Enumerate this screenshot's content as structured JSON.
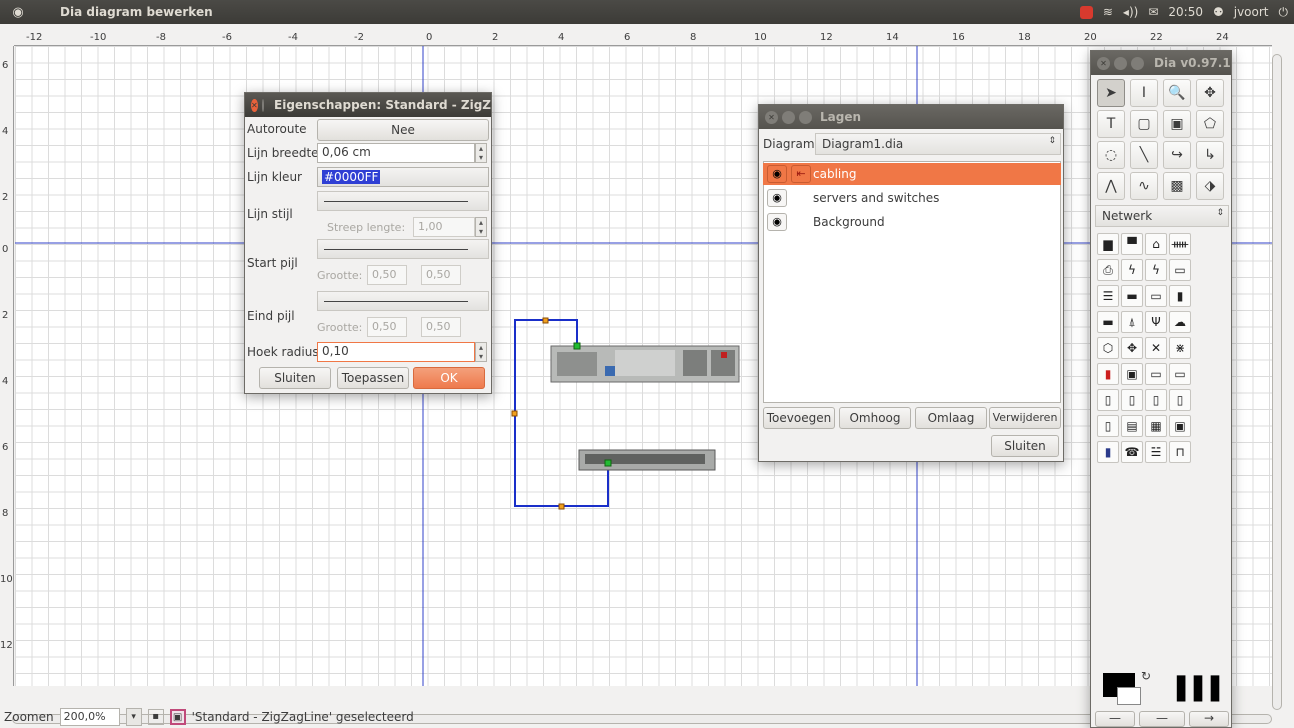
{
  "topbar": {
    "title": "Dia diagram bewerken",
    "time": "20:50",
    "user": "jvoort",
    "icons": [
      "app-logo-icon",
      "notification-icon",
      "wifi-icon",
      "volume-icon",
      "mail-icon",
      "user-icon",
      "power-icon"
    ]
  },
  "ruler": {
    "h_labels": [
      "-12",
      "-10",
      "-8",
      "-6",
      "-4",
      "-2",
      "0",
      "2",
      "4",
      "6",
      "8",
      "10",
      "12",
      "14",
      "16",
      "18",
      "20",
      "22",
      "24"
    ],
    "v_labels": [
      "6",
      "4",
      "2",
      "0",
      "2",
      "4",
      "6",
      "8",
      "10",
      "12"
    ]
  },
  "statusbar": {
    "zoom_label": "Zoomen",
    "zoom_value": "200,0%",
    "selection": "'Standard - ZigZagLine' geselecteerd"
  },
  "properties": {
    "title": "Eigenschappen: Standard - ZigZ",
    "autoroute_label": "Autoroute",
    "autoroute_value": "Nee",
    "line_width_label": "Lijn breedte",
    "line_width_value": "0,06 cm",
    "line_color_label": "Lijn kleur",
    "line_color_value": "#0000FF",
    "line_style_label": "Lijn stijl",
    "dash_length_label": "Streep lengte:",
    "dash_length_value": "1,00",
    "start_arrow_label": "Start pijl",
    "end_arrow_label": "Eind pijl",
    "size_label": "Grootte:",
    "size_w": "0,50",
    "size_h": "0,50",
    "corner_radius_label": "Hoek radius",
    "corner_radius_value": "0,10",
    "close_label": "Sluiten",
    "apply_label": "Toepassen",
    "ok_label": "OK"
  },
  "layers": {
    "title": "Lagen",
    "diagram_label": "Diagram:",
    "diagram_value": "Diagram1.dia",
    "items": [
      {
        "name": "cabling",
        "selected": true
      },
      {
        "name": "servers and switches",
        "selected": false
      },
      {
        "name": "Background",
        "selected": false
      }
    ],
    "add_label": "Toevoegen",
    "raise_label": "Omhoog",
    "lower_label": "Omlaag",
    "delete_label": "Verwijderen",
    "close_label": "Sluiten"
  },
  "toolbox": {
    "title": "Dia v0.97.1",
    "sheet_value": "Netwerk",
    "tools": [
      "pointer",
      "text-edit",
      "magnify",
      "scroll",
      "text",
      "box",
      "image",
      "polygon",
      "bezier-shape",
      "line",
      "arc",
      "zigzag",
      "polyline",
      "bezier",
      "outline",
      "image-object"
    ],
    "shapes": [
      "pc-tower",
      "monitor",
      "disk",
      "hub",
      "printer",
      "lightning",
      "cable",
      "modem",
      "rack-server",
      "patch-panel",
      "module",
      "ups",
      "bridge",
      "antenna",
      "tool",
      "cloud",
      "hexagon",
      "router",
      "switch",
      "firewall",
      "server-red",
      "workstation",
      "flat",
      "router-small",
      "device-1",
      "device-2",
      "device-3",
      "device-4",
      "device-5",
      "device-6",
      "device-7",
      "device-8",
      "phone",
      "telephone",
      "hub2",
      "printer2"
    ]
  },
  "colors": {
    "accent": "#f07746",
    "line_blue": "#1a2fc9",
    "title_bar": "#3c3b37"
  }
}
